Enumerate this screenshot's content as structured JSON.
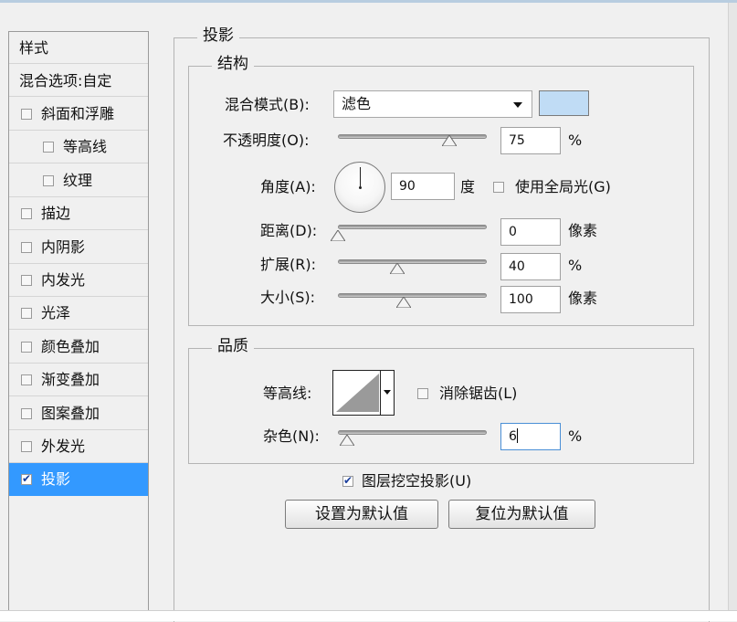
{
  "window": {
    "accent_color": "#3399ff",
    "title_strip_color": "#b8cde0"
  },
  "styles_panel": {
    "title": "样式",
    "blend_options": "混合选项:自定",
    "items": [
      {
        "label": "斜面和浮雕",
        "checked": false,
        "indent": false
      },
      {
        "label": "等高线",
        "checked": false,
        "indent": true
      },
      {
        "label": "纹理",
        "checked": false,
        "indent": true
      },
      {
        "label": "描边",
        "checked": false,
        "indent": false
      },
      {
        "label": "内阴影",
        "checked": false,
        "indent": false
      },
      {
        "label": "内发光",
        "checked": false,
        "indent": false
      },
      {
        "label": "光泽",
        "checked": false,
        "indent": false
      },
      {
        "label": "颜色叠加",
        "checked": false,
        "indent": false
      },
      {
        "label": "渐变叠加",
        "checked": false,
        "indent": false
      },
      {
        "label": "图案叠加",
        "checked": false,
        "indent": false
      },
      {
        "label": "外发光",
        "checked": false,
        "indent": false
      },
      {
        "label": "投影",
        "checked": true,
        "indent": false,
        "selected": true
      }
    ]
  },
  "drop_shadow": {
    "title": "投影",
    "structure": {
      "title": "结构",
      "blend_mode_label": "混合模式(B):",
      "blend_mode_value": "滤色",
      "shadow_color": "#c0dcf5",
      "opacity_label": "不透明度(O):",
      "opacity_value": "75",
      "opacity_unit": "%",
      "opacity_fraction": 0.75,
      "angle_label": "角度(A):",
      "angle_value": "90",
      "angle_unit": "度",
      "global_light_label": "使用全局光(G)",
      "global_light_checked": false,
      "distance_label": "距离(D):",
      "distance_value": "0",
      "distance_unit": "像素",
      "distance_fraction": 0.0,
      "spread_label": "扩展(R):",
      "spread_value": "40",
      "spread_unit": "%",
      "spread_fraction": 0.4,
      "size_label": "大小(S):",
      "size_value": "100",
      "size_unit": "像素",
      "size_fraction": 0.44
    },
    "quality": {
      "title": "品质",
      "contour_label": "等高线:",
      "antialias_label": "消除锯齿(L)",
      "antialias_checked": false,
      "noise_label": "杂色(N):",
      "noise_value": "6",
      "noise_unit": "%",
      "noise_fraction": 0.06
    },
    "knockout_label": "图层挖空投影(U)",
    "knockout_checked": true,
    "set_default_button": "设置为默认值",
    "reset_default_button": "复位为默认值"
  }
}
